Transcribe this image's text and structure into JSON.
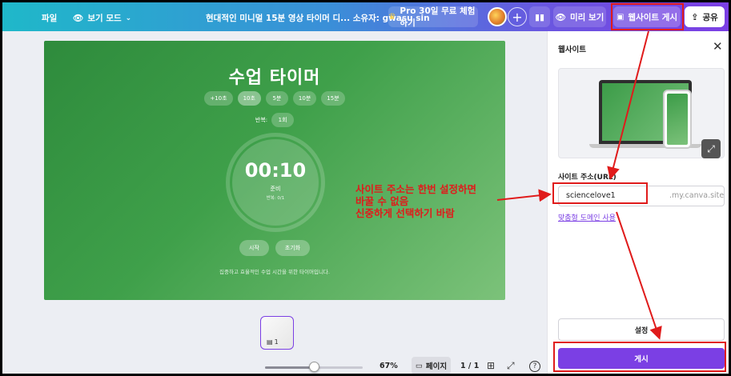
{
  "topbar": {
    "file_label": "파일",
    "view_mode_label": "보기 모드",
    "doc_title": "현대적인 미니멀 15분 영상 타이머 디... 소유자: gwasu sin",
    "pro_label": "Pro 30일 무료 체험하기",
    "plus_label": "+",
    "preview_label": "미리 보기",
    "publish_site_label": "웹사이트 게시",
    "share_label": "공유"
  },
  "slide": {
    "title": "수업 타이머",
    "chips": [
      "+10초",
      "10초",
      "5분",
      "10분",
      "15분"
    ],
    "repeat_label": "반복:",
    "repeat_value": "1회",
    "time": "00:10",
    "status": "준비",
    "repeat_count": "반복: 0/1",
    "start_label": "시작",
    "reset_label": "초기화",
    "footer": "집중하고 효율적인 수업 시간을 위한 타이머입니다."
  },
  "pages": {
    "thumb_number": "1",
    "zoom": "67%",
    "zoom_fraction": 0.5,
    "page_label": "페이지",
    "page_count": "1 / 1",
    "help": "?"
  },
  "annotation": {
    "line1": "사이트 주소는 한번 설정하면",
    "line2": "바꿀 수 없음",
    "line3": "신중하게 선택하기 바람"
  },
  "panel": {
    "title": "웹사이트",
    "url_label": "사이트 주소(URL)",
    "url_value": "sciencelove1",
    "url_suffix": ".my.canva.site",
    "custom_domain": "맞춤형 도메인 사용",
    "settings_label": "설정",
    "publish_label": "게시"
  },
  "colors": {
    "accent": "#7b3fe4",
    "annotation": "#e01b1b",
    "slide_green": "#3fa04a"
  }
}
